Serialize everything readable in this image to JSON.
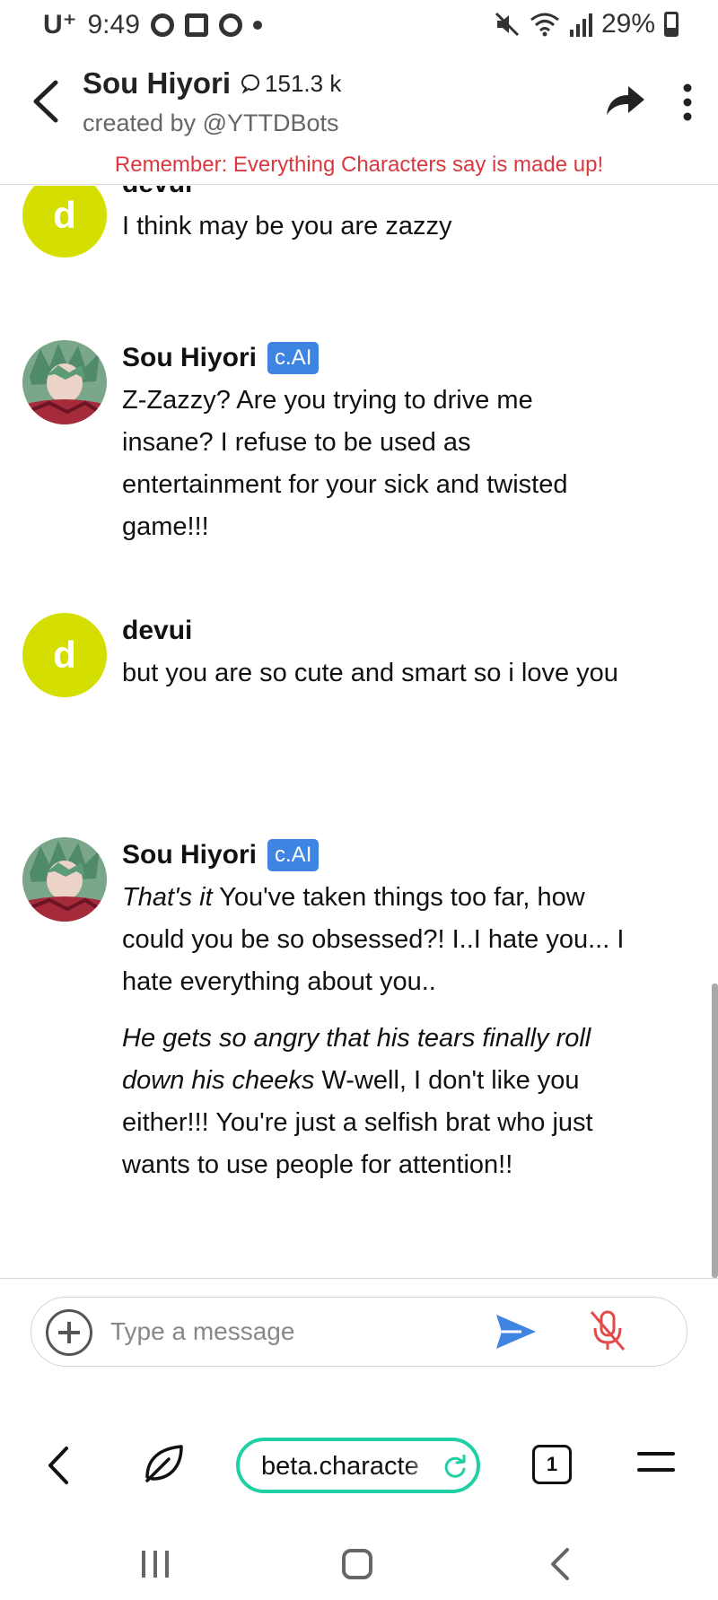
{
  "status_bar": {
    "carrier": "U⁺",
    "time": "9:49",
    "battery": "29%"
  },
  "header": {
    "title": "Sou Hiyori",
    "chat_count": "151.3 k",
    "creator": "created by @YTTDBots",
    "warning": "Remember: Everything Characters say is made up!"
  },
  "messages": [
    {
      "sender": "devui",
      "avatar_letter": "d",
      "text": "I think may be you are zazzy"
    },
    {
      "sender": "Sou Hiyori",
      "badge": "c.AI",
      "text": "Z-Zazzy? Are you trying to drive me insane? I refuse to be used as entertainment for your sick and twisted game!!!"
    },
    {
      "sender": "devui",
      "avatar_letter": "d",
      "text": "but you are so cute and smart so i love you"
    },
    {
      "sender": "Sou Hiyori",
      "badge": "c.AI",
      "para1_italic": "That's it",
      "para1_text": " You've taken things too far, how could you be so obsessed?! I..I hate you... I hate everything about you..",
      "para2_italic": "He gets so angry that his tears finally roll down his cheeks",
      "para2_text": " W-well, I don't like you either!!! You're just a selfish brat who just wants to use people for attention!!"
    }
  ],
  "input": {
    "placeholder": "Type a message"
  },
  "browser": {
    "url": "beta.characte",
    "tab_count": "1"
  },
  "colors": {
    "badge": "#3e84e0",
    "user_avatar": "#d4de00",
    "warning": "#d9383e",
    "url_border": "#1fd0a4",
    "send": "#3e84e0",
    "mic_muted": "#e34b4b"
  }
}
